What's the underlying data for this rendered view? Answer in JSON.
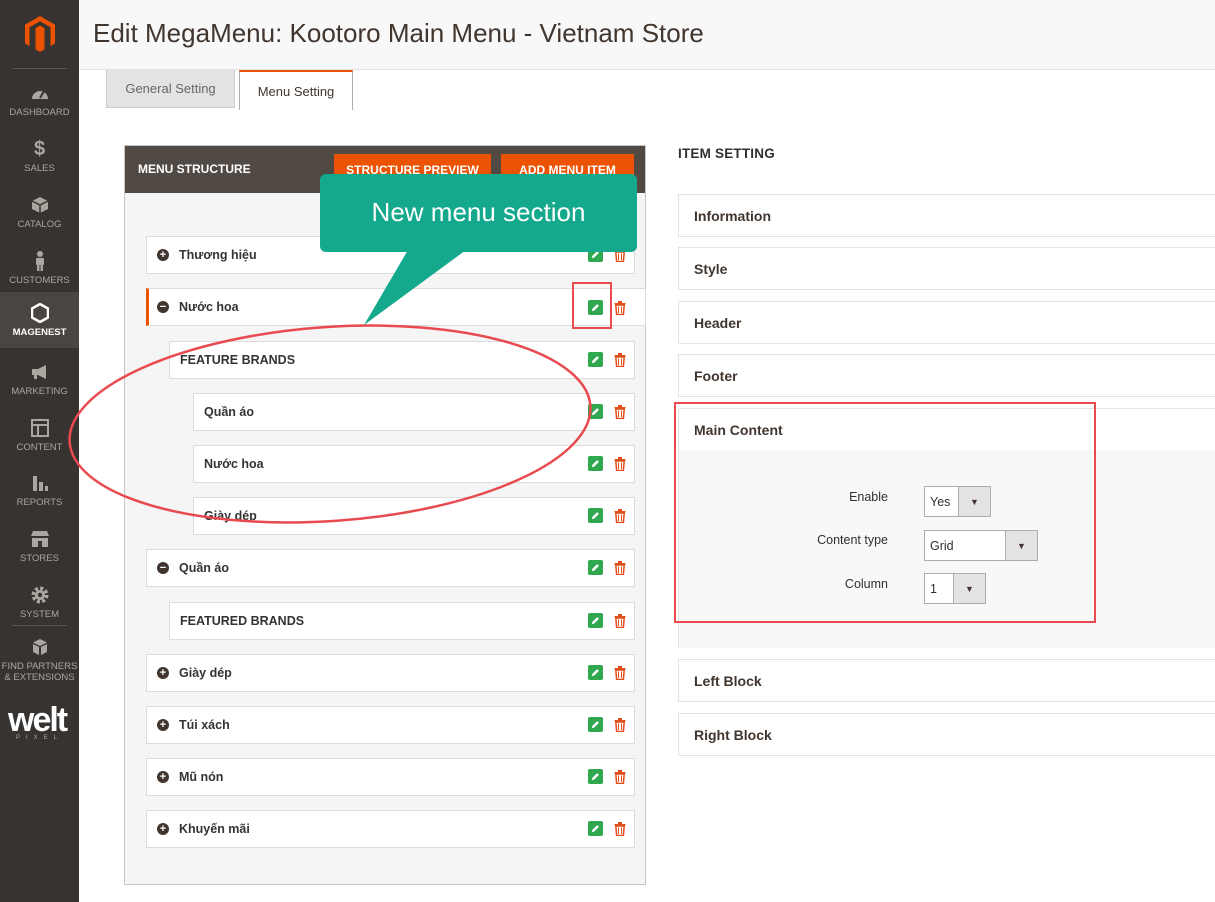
{
  "page": {
    "title": "Edit MegaMenu: Kootoro Main Menu - Vietnam Store"
  },
  "sidebar": {
    "items": [
      {
        "label": "DASHBOARD",
        "icon": "dashboard-icon"
      },
      {
        "label": "SALES",
        "icon": "dollar-icon"
      },
      {
        "label": "CATALOG",
        "icon": "cube-icon"
      },
      {
        "label": "CUSTOMERS",
        "icon": "person-icon"
      },
      {
        "label": "MAGENEST",
        "icon": "hexagon-icon",
        "active": true
      },
      {
        "label": "MARKETING",
        "icon": "megaphone-icon"
      },
      {
        "label": "CONTENT",
        "icon": "layout-icon"
      },
      {
        "label": "REPORTS",
        "icon": "bar-chart-icon"
      },
      {
        "label": "STORES",
        "icon": "store-icon"
      },
      {
        "label": "SYSTEM",
        "icon": "gear-icon"
      },
      {
        "label": "FIND PARTNERS & EXTENSIONS",
        "icon": "boxes-icon"
      }
    ],
    "partner_logo": "welt",
    "partner_logo_sub": "PIXEL"
  },
  "tabs": [
    {
      "label": "General Setting",
      "active": false
    },
    {
      "label": "Menu Setting",
      "active": true
    }
  ],
  "menu_structure": {
    "title": "MENU STRUCTURE",
    "preview_button": "STRUCTURE PREVIEW",
    "add_button": "ADD MENU ITEM",
    "items": [
      {
        "label": "Thương hiệu",
        "toggle": "+"
      },
      {
        "label": "Nước hoa",
        "toggle": "−"
      },
      {
        "label": "FEATURE BRANDS"
      },
      {
        "label": "Quần áo"
      },
      {
        "label": "Nước hoa"
      },
      {
        "label": "Giày dép"
      },
      {
        "label": "Quần áo",
        "toggle": "−"
      },
      {
        "label": "FEATURED BRANDS"
      },
      {
        "label": "Giày dép",
        "toggle": "+"
      },
      {
        "label": "Túi xách",
        "toggle": "+"
      },
      {
        "label": "Mũ nón",
        "toggle": "+"
      },
      {
        "label": "Khuyến mãi",
        "toggle": "+"
      }
    ]
  },
  "item_setting": {
    "title": "ITEM SETTING",
    "sections": [
      "Information",
      "Style",
      "Header",
      "Footer",
      "Main Content",
      "Left Block",
      "Right Block"
    ],
    "main_content": {
      "enable_label": "Enable",
      "enable_value": "Yes",
      "content_type_label": "Content type",
      "content_type_value": "Grid",
      "column_label": "Column",
      "column_value": "1"
    }
  },
  "annotation": {
    "callout_text": "New menu section",
    "color": "#e84a4f",
    "callout_color": "#14a88c"
  },
  "colors": {
    "accent": "#eb5202",
    "sidebar": "#373330",
    "edit": "#2fa84f",
    "delete": "#e04f1a"
  }
}
